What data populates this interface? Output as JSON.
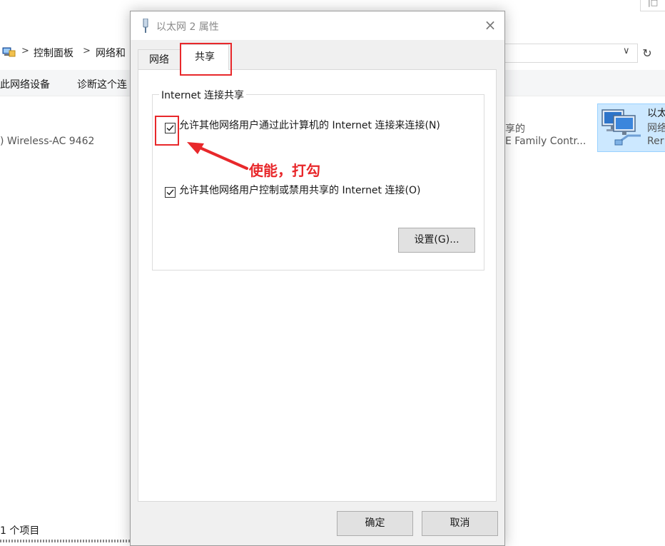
{
  "background": {
    "breadcrumb": [
      "控制面板",
      "网络和"
    ],
    "commands": [
      "此网络设备",
      "诊断这个连"
    ],
    "adapter_left_name": ") Wireless-AC 9462",
    "adapter_mid_status": "享的",
    "adapter_mid_device": "E Family Contr...",
    "adapter_right_name": "以太",
    "adapter_right_status": "网络",
    "adapter_right_device": "Rer",
    "status_count": "1 个项目"
  },
  "dialog": {
    "title": "以太网 2 属性",
    "close_glyph": "×",
    "tabs": [
      {
        "label": "网络",
        "active": false
      },
      {
        "label": "共享",
        "active": true
      }
    ],
    "group_title": "Internet 连接共享",
    "checkboxes": [
      {
        "label": "允许其他网络用户通过此计算机的 Internet 连接来连接(N)",
        "checked": true
      },
      {
        "label": "允许其他网络用户控制或禁用共享的 Internet 连接(O)",
        "checked": true
      }
    ],
    "settings_button": "设置(G)...",
    "ok_button": "确定",
    "cancel_button": "取消"
  },
  "annotation": {
    "text": "使能，打勾",
    "color": "#e8282b"
  },
  "colors": {
    "highlight_red": "#e8282b",
    "selection_blue": "#cce8ff",
    "dialog_bg": "#f0f0f0"
  }
}
